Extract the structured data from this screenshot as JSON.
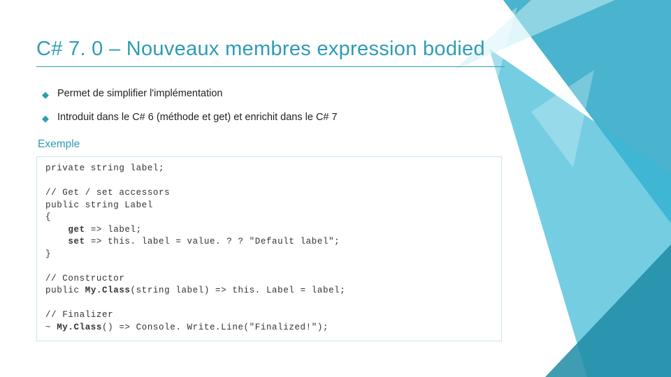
{
  "title": "C# 7. 0 – Nouveaux membres expression bodied",
  "bullets": [
    "Permet de simplifier l'implémentation",
    "Introduit dans le C# 6 (méthode et get) et enrichit dans le C# 7"
  ],
  "example_label": "Exemple",
  "code": {
    "l1": "private string label;",
    "l2": "// Get / set accessors",
    "l3": "public string Label",
    "l4": "{",
    "l5_pre": "    ",
    "l5_kw": "get",
    "l5_post": " => label;",
    "l6_pre": "    ",
    "l6_kw": "set",
    "l6_post": " => this. label = value. ? ? \"Default label\";",
    "l7": "}",
    "l8": "// Constructor",
    "l9a": "public ",
    "l9b": "My.Class",
    "l9c": "(string label) => this. Label = label;",
    "l10": "// Finalizer",
    "l11a": "~ ",
    "l11b": "My.Class",
    "l11c": "() => Console. Write.Line(\"Finalized!\");"
  }
}
